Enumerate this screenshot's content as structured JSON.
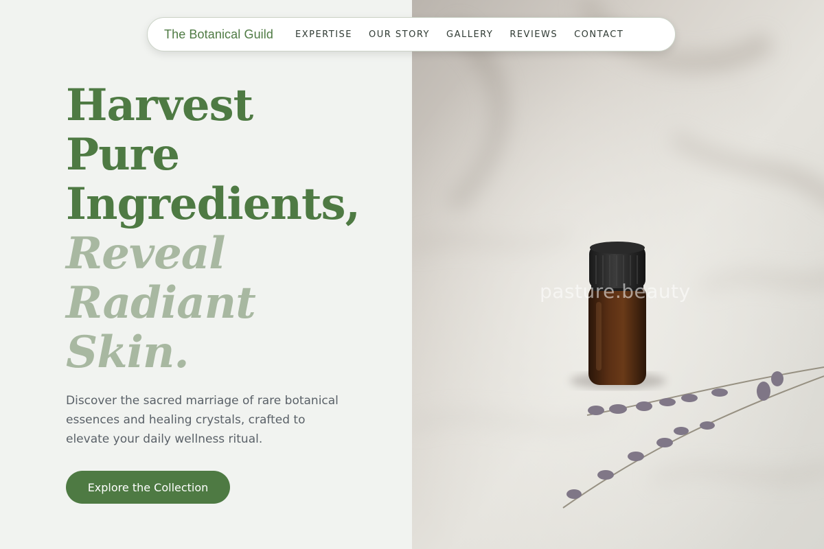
{
  "nav": {
    "brand": "The Botanical Guild",
    "links": [
      "EXPERTISE",
      "OUR STORY",
      "GALLERY",
      "REVIEWS",
      "CONTACT"
    ]
  },
  "hero": {
    "headline_lines": [
      "Harvest",
      "Pure",
      "Ingredients,"
    ],
    "headline_italic_lines": [
      "Reveal",
      "Radiant",
      "Skin."
    ],
    "subtext": "Discover the sacred marriage of rare botanical essences and healing crystals, crafted to elevate your daily wellness ritual.",
    "cta_label": "Explore the Collection"
  },
  "photo": {
    "subject": "amber essential oil bottle with black cap and dried lavender sprigs on white linen",
    "watermark": "pasture.beauty"
  },
  "colors": {
    "accent_green": "#4e7a43",
    "soft_green": "#a8b8a1",
    "background": "#f1f3f0",
    "body_text": "#5a6168"
  }
}
